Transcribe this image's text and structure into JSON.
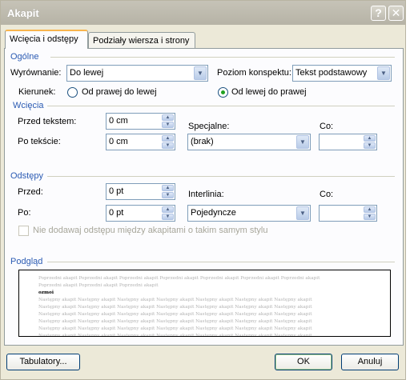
{
  "window": {
    "title": "Akapit"
  },
  "titlebar": {
    "help_symbol": "?",
    "close_symbol": "✕"
  },
  "tabs": [
    {
      "label": "Wcięcia i odstępy",
      "active": true
    },
    {
      "label": "Podziały wiersza i strony",
      "active": false
    }
  ],
  "general": {
    "heading": "Ogólne",
    "alignment_label": "Wyrównanie:",
    "alignment_value": "Do lewej",
    "outline_label": "Poziom konspektu:",
    "outline_value": "Tekst podstawowy",
    "direction_label": "Kierunek:",
    "direction_rtl": "Od prawej do lewej",
    "direction_ltr": "Od lewej do prawej",
    "direction_selected": "ltr"
  },
  "indentation": {
    "heading": "Wcięcia",
    "before_label": "Przed tekstem:",
    "before_value": "0 cm",
    "after_label": "Po tekście:",
    "after_value": "0 cm",
    "special_label": "Specjalne:",
    "special_value": "(brak)",
    "by_label": "Co:",
    "by_value": ""
  },
  "spacing": {
    "heading": "Odstępy",
    "before_label": "Przed:",
    "before_value": "0 pt",
    "after_label": "Po:",
    "after_value": "0 pt",
    "line_label": "Interlinia:",
    "line_value": "Pojedyncze",
    "at_label": "Co:",
    "at_value": "",
    "no_space_label": "Nie dodawaj odstępu między akapitami o takim samym stylu",
    "no_space_checked": false
  },
  "preview": {
    "heading": "Podgląd",
    "prev_line_1": "Poprzedni akapit Poprzedni akapit Poprzedni akapit Poprzedni akapit Poprzedni akapit Poprzedni akapit Poprzedni akapit",
    "prev_line_2": "Poprzedni akapit Poprzedni akapit Poprzedni akapit",
    "current": "ozmoi",
    "next_line": "Następny akapit Następny akapit Następny akapit Następny akapit Następny akapit Następny akapit Następny akapit"
  },
  "buttons": {
    "tabs": "Tabulatory...",
    "ok": "OK",
    "cancel": "Anuluj"
  }
}
